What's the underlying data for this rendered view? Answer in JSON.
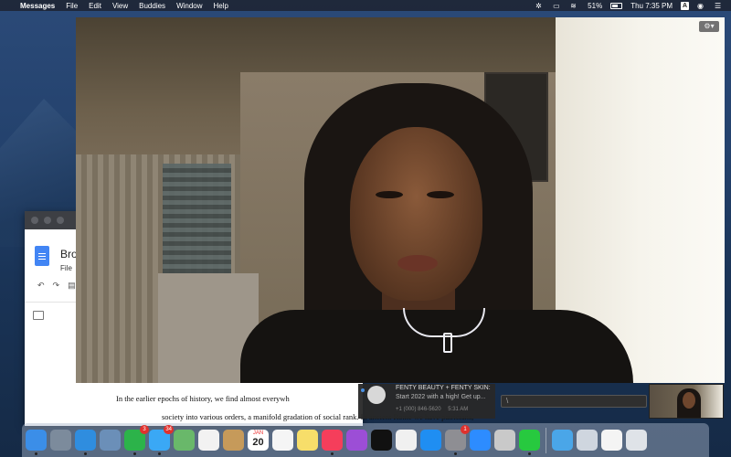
{
  "menubar": {
    "apple_icon": "apple-icon",
    "app_name": "Messages",
    "items": [
      "File",
      "Edit",
      "View",
      "Buddies",
      "Window",
      "Help"
    ],
    "battery_pct": "51%",
    "clock": "Thu 7:35 PM",
    "input_source": "A"
  },
  "doc_window": {
    "title": "Bro",
    "menu": "File",
    "body_lines": [
      "In the earlier epochs of history, we find almost everywh",
      "society into various orders, a manifold gradation of social rank. In ancient Rome we have patricians,"
    ]
  },
  "video_window": {
    "settings_icon": "gear-icon"
  },
  "notification": {
    "title": "FENTY BEAUTY + FENTY SKIN:",
    "body": "Start 2022 with a high! Get up...",
    "meta": "+1 (000) 846-5620",
    "time": "5:31 AM",
    "reply_placeholder": "\\"
  },
  "dock": {
    "apps": [
      {
        "name": "finder",
        "color": "#3b8ee8",
        "running": true
      },
      {
        "name": "launchpad",
        "color": "#7c8b9c",
        "running": false
      },
      {
        "name": "safari",
        "color": "#2f8ddf",
        "running": true
      },
      {
        "name": "preview",
        "color": "#6b8fb8",
        "running": false
      },
      {
        "name": "facetime",
        "color": "#2cb34a",
        "running": true,
        "badge": "3"
      },
      {
        "name": "messages",
        "color": "#3aa8f5",
        "running": true,
        "badge": "34"
      },
      {
        "name": "maps",
        "color": "#69b86a",
        "running": false
      },
      {
        "name": "photos",
        "color": "#f2f2f2",
        "running": false
      },
      {
        "name": "contacts",
        "color": "#c69a5a",
        "running": false
      },
      {
        "name": "calendar",
        "color": "#ffffff",
        "running": false,
        "cal_month": "JAN",
        "cal_day": "20"
      },
      {
        "name": "reminders",
        "color": "#f5f5f5",
        "running": false
      },
      {
        "name": "notes",
        "color": "#f7de6a",
        "running": false
      },
      {
        "name": "music",
        "color": "#f53e5b",
        "running": true
      },
      {
        "name": "podcasts",
        "color": "#9c4ed6",
        "running": false
      },
      {
        "name": "tv",
        "color": "#111111",
        "running": false
      },
      {
        "name": "news",
        "color": "#f0f0f0",
        "running": false
      },
      {
        "name": "app-store",
        "color": "#1f8ef2",
        "running": false
      },
      {
        "name": "system-preferences",
        "color": "#8e8e93",
        "running": true,
        "badge": "1"
      },
      {
        "name": "zoom",
        "color": "#2d8cff",
        "running": false
      },
      {
        "name": "image-capture",
        "color": "#c9c9c9",
        "running": false
      },
      {
        "name": "facetime-call",
        "color": "#27c93f",
        "running": true
      }
    ],
    "right": [
      {
        "name": "downloads-folder",
        "color": "#4aa6e8"
      },
      {
        "name": "help",
        "color": "#cfd6df"
      },
      {
        "name": "document",
        "color": "#f4f4f4"
      },
      {
        "name": "trash",
        "color": "#dfe3e8"
      }
    ]
  }
}
